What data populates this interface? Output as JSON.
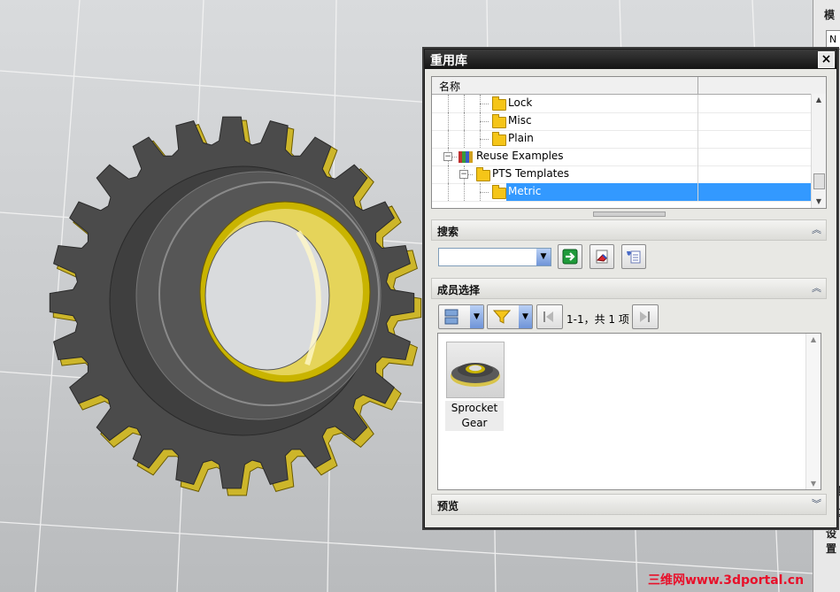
{
  "dialog": {
    "title": "重用库",
    "close_label": "×",
    "tree": {
      "column_name": "名称",
      "rows": [
        {
          "label": "Lock",
          "kind": "folder",
          "indent": 3,
          "selected": false
        },
        {
          "label": "Misc",
          "kind": "folder",
          "indent": 3,
          "selected": false
        },
        {
          "label": "Plain",
          "kind": "folder",
          "indent": 3,
          "selected": false
        },
        {
          "label": "Reuse Examples",
          "kind": "library",
          "indent": 1,
          "selected": false,
          "expander": "−"
        },
        {
          "label": "PTS Templates",
          "kind": "folder",
          "indent": 2,
          "selected": false,
          "expander": "−"
        },
        {
          "label": "Metric",
          "kind": "folder",
          "indent": 3,
          "selected": true
        }
      ],
      "scroll_up": "▲",
      "scroll_down": "▼"
    },
    "search": {
      "title": "搜索",
      "collapse_icon": "︽",
      "combo_value": "",
      "combo_arrow": "▼"
    },
    "member_select": {
      "title": "成员选择",
      "collapse_icon": "︽",
      "dropdown_arrow": "▼",
      "pager_text": "1-1，共 1 项",
      "items": [
        {
          "caption_line1": "Sprocket",
          "caption_line2": "Gear"
        }
      ],
      "scroll_up": "▲",
      "scroll_down": "▼"
    },
    "preview": {
      "title": "预览",
      "expand_icon": "︾"
    }
  },
  "right_panel": {
    "tab_label": "模",
    "box_label": "N",
    "side_labels": [
      "置",
      "过",
      "设置"
    ]
  },
  "watermark": "三维网www.3dportal.cn",
  "colors": {
    "selection": "#3399ff",
    "gear_body": "#4a4a4a",
    "gear_bushing": "#c9b400",
    "title_bar": "#1f1f1f",
    "watermark": "#e8102a"
  }
}
